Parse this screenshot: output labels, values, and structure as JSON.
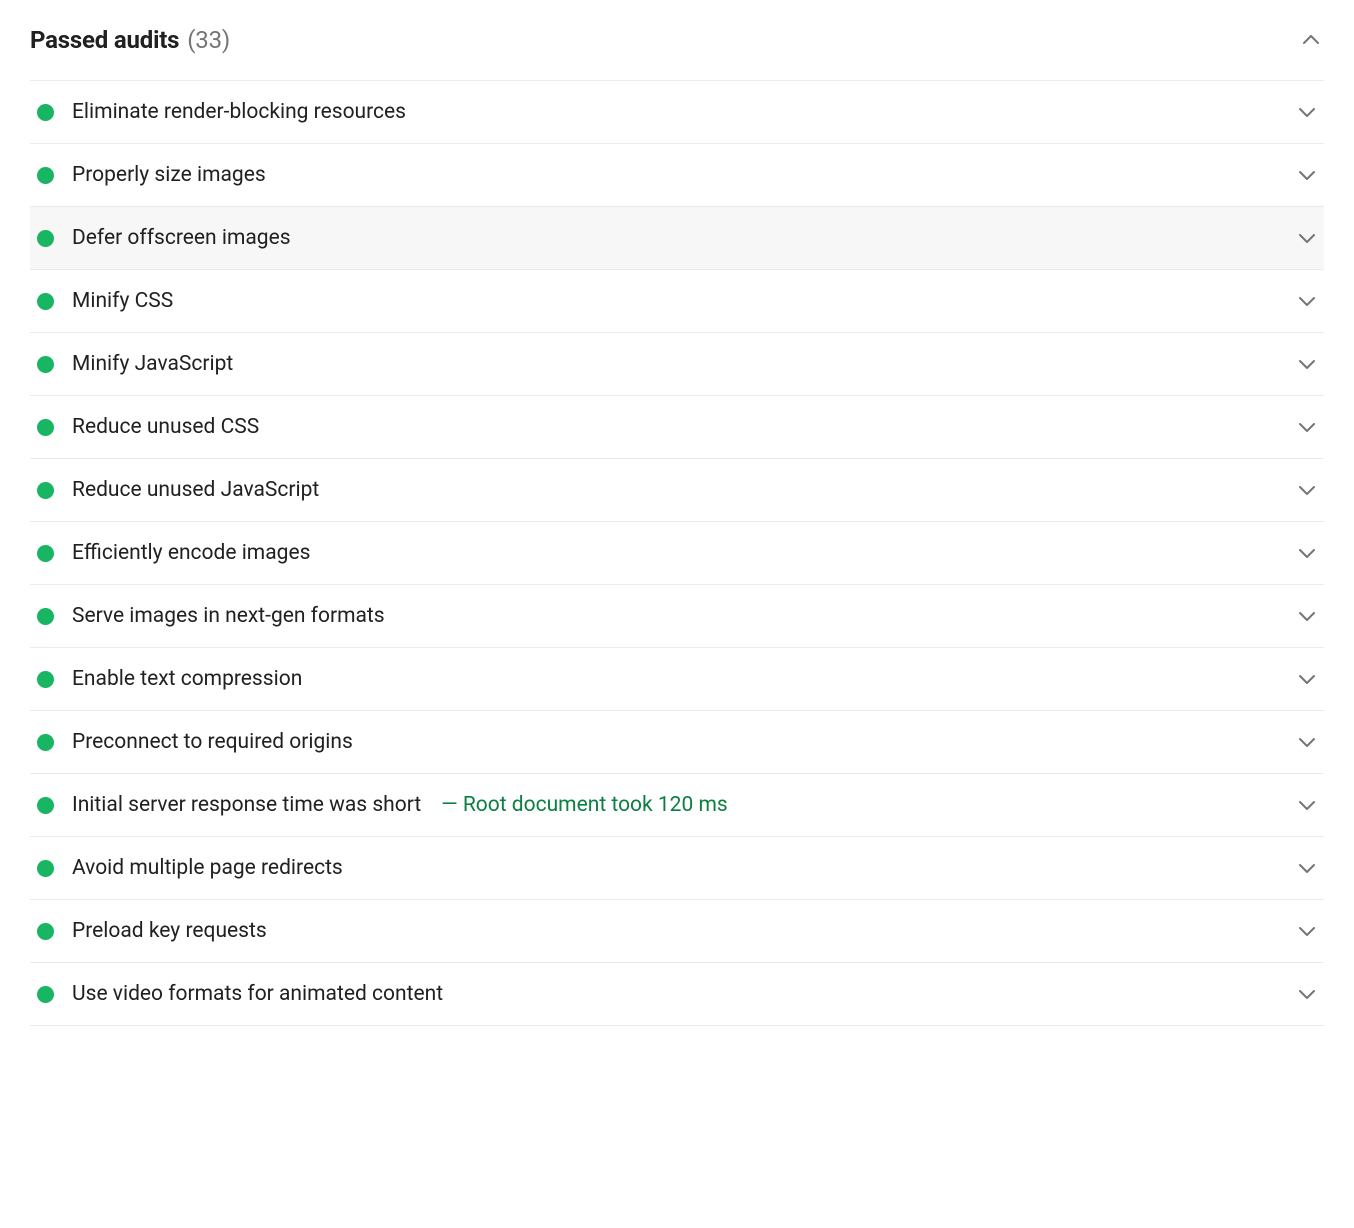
{
  "header": {
    "title": "Passed audits",
    "count": "(33)"
  },
  "colors": {
    "pass": "#18b663",
    "divider": "#ebebeb",
    "muted": "#757575",
    "detail": "#0c7f42"
  },
  "audits": [
    {
      "title": "Eliminate render-blocking resources",
      "detail": ""
    },
    {
      "title": "Properly size images",
      "detail": ""
    },
    {
      "title": "Defer offscreen images",
      "detail": "",
      "hovered": true
    },
    {
      "title": "Minify CSS",
      "detail": ""
    },
    {
      "title": "Minify JavaScript",
      "detail": ""
    },
    {
      "title": "Reduce unused CSS",
      "detail": ""
    },
    {
      "title": "Reduce unused JavaScript",
      "detail": ""
    },
    {
      "title": "Efficiently encode images",
      "detail": ""
    },
    {
      "title": "Serve images in next-gen formats",
      "detail": ""
    },
    {
      "title": "Enable text compression",
      "detail": ""
    },
    {
      "title": "Preconnect to required origins",
      "detail": ""
    },
    {
      "title": "Initial server response time was short",
      "detail": "— Root document took 120 ms"
    },
    {
      "title": "Avoid multiple page redirects",
      "detail": ""
    },
    {
      "title": "Preload key requests",
      "detail": ""
    },
    {
      "title": "Use video formats for animated content",
      "detail": ""
    }
  ]
}
